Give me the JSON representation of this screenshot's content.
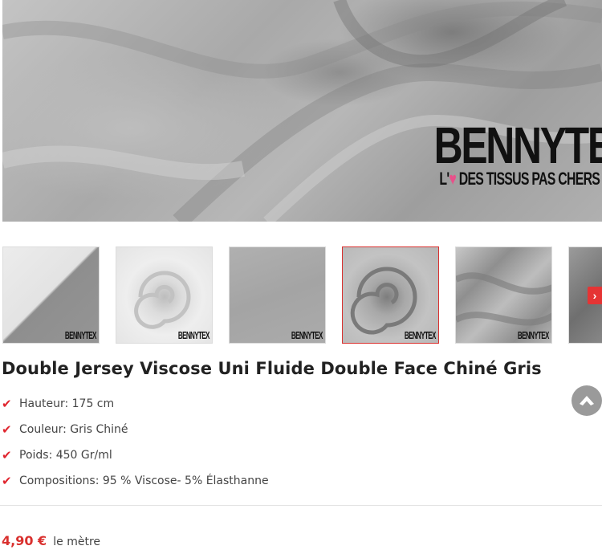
{
  "main_image": {
    "logo_word": "BENNYTEX",
    "logo_tagline_pre": "L'",
    "logo_heart": "♥",
    "logo_tagline_post": " DES TISSUS PAS CHERS"
  },
  "thumbnails": {
    "items": [
      {
        "logo": "BENNYTEX",
        "active": false
      },
      {
        "logo": "BENNYTEX",
        "active": false
      },
      {
        "logo": "BENNYTEX",
        "active": false
      },
      {
        "logo": "BENNYTEX",
        "active": true
      },
      {
        "logo": "BENNYTEX",
        "active": false
      },
      {
        "logo": "",
        "active": false
      }
    ],
    "next_icon": "chevron-right-icon",
    "next_glyph": "›"
  },
  "product": {
    "title": "Double Jersey Viscose Uni Fluide Double Face Chiné Gris",
    "features": [
      "Hauteur: 175 cm",
      "Couleur: Gris Chiné",
      "Poids: 450 Gr/ml",
      "Compositions: 95 % Viscose- 5% Élasthanne"
    ],
    "check_glyph": "✔",
    "price": "4,90 €",
    "price_unit": "le mètre"
  },
  "scroll_top": {
    "icon": "arrow-up-icon"
  },
  "colors": {
    "accent": "#d9302e",
    "check": "#e0262f",
    "scroll_button": "#9a9a9a"
  }
}
